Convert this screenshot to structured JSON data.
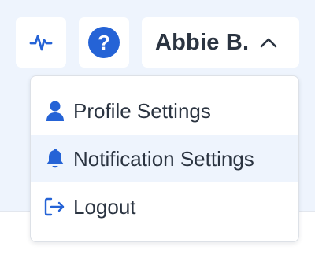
{
  "header": {
    "user_name": "Abbie B.",
    "help_glyph": "?",
    "activity_icon": "activity-pulse-icon",
    "help_icon": "question-circle-icon",
    "chevron_icon": "chevron-up-icon"
  },
  "user_menu": {
    "items": [
      {
        "label": "Profile Settings",
        "icon": "user-icon",
        "highlighted": false
      },
      {
        "label": "Notification Settings",
        "icon": "bell-icon",
        "highlighted": true
      },
      {
        "label": "Logout",
        "icon": "logout-icon",
        "highlighted": false
      }
    ]
  },
  "colors": {
    "accent": "#2563d6",
    "background": "#eef4fd",
    "text": "#2b3441",
    "hover": "#eef4fd"
  }
}
